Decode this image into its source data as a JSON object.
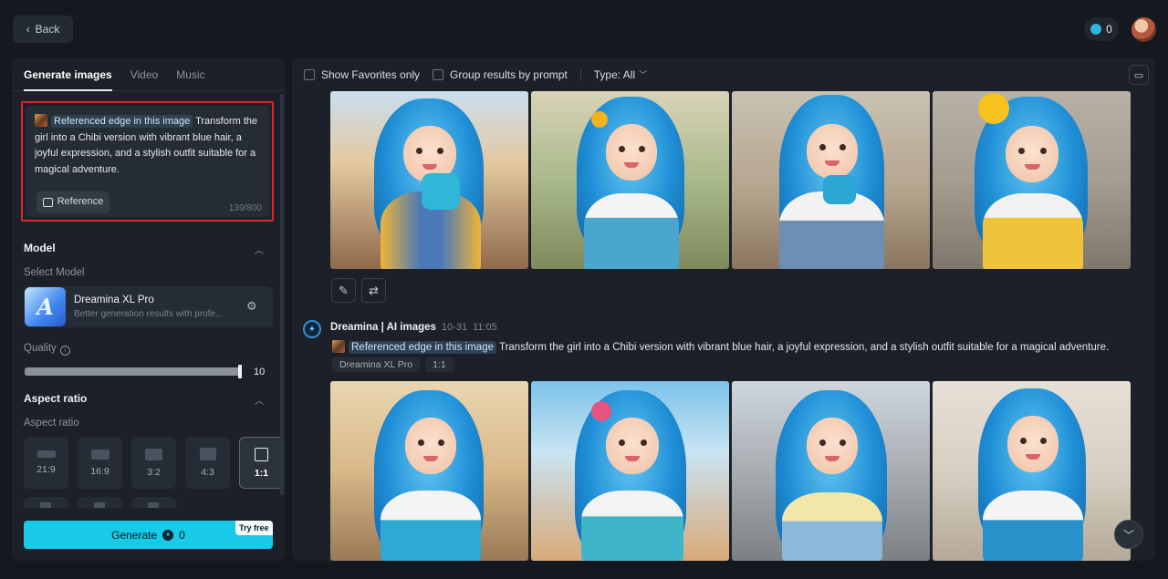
{
  "topbar": {
    "back_label": "Back",
    "credits": "0"
  },
  "left": {
    "tabs": [
      "Generate images",
      "Video",
      "Music"
    ],
    "prompt": {
      "reference_chip": "Referenced edge in this image",
      "text": " Transform the girl into a Chibi version with vibrant blue hair, a joyful expression, and a stylish outfit suitable for a magical adventure.",
      "reference_button": "Reference",
      "char_count": "139/800"
    },
    "model_section": "Model",
    "select_model_label": "Select Model",
    "model": {
      "name": "Dreamina XL Pro",
      "description": "Better generation results with profe..."
    },
    "quality_label": "Quality",
    "quality_value": 10,
    "quality_value_text": "10",
    "aspect_section": "Aspect ratio",
    "aspect_label": "Aspect ratio",
    "ratios": [
      "21:9",
      "16:9",
      "3:2",
      "4:3",
      "1:1"
    ],
    "selected_ratio": "1:1",
    "generate_label": "Generate",
    "generate_cost": "0",
    "try_free": "Try free"
  },
  "main": {
    "show_favorites": "Show Favorites only",
    "group_by_prompt": "Group results by prompt",
    "type_filter": "Type: All",
    "entry": {
      "brand": "Dreamina | AI images",
      "date": "10-31",
      "time": "11:05",
      "reference_chip": "Referenced edge in this image",
      "prompt": " Transform the girl into a Chibi version with vibrant blue hair, a joyful expression, and a stylish outfit suitable for a magical adventure.",
      "model_tag": "Dreamina XL Pro",
      "ratio_tag": "1:1"
    }
  },
  "colors": {
    "accent": "#19c9e8",
    "highlight_border": "#e0262b"
  }
}
